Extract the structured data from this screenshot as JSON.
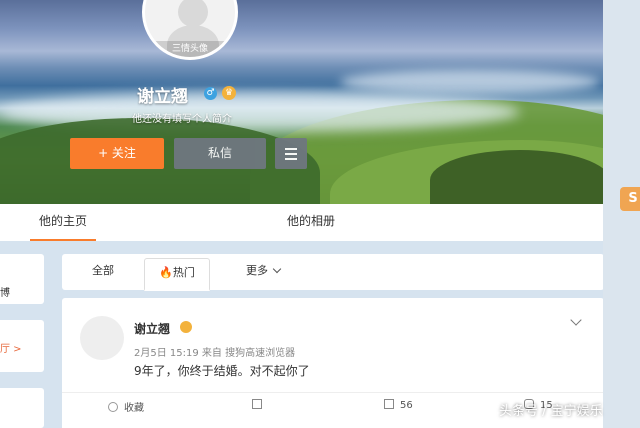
{
  "profile": {
    "avatar_caption": "三情头像",
    "username": "谢立翘",
    "gender_icon": "♂",
    "crown_icon": "♛",
    "bio": "他还没有填写个人简介",
    "follow_label": "+ 关注",
    "message_label": "私信"
  },
  "tabs": {
    "home": "他的主页",
    "album": "他的相册"
  },
  "sidebar": {
    "card1_text": "博",
    "card2_text": "厅 >"
  },
  "feed_tabs": {
    "all": "全部",
    "hot": "🔥热门",
    "more": "更多"
  },
  "post": {
    "author": "谢立翘",
    "meta": "2月5日 15:19 来自 搜狗高速浏览器",
    "text": "9年了，你终于结婚。对不起你了",
    "favorite": "收藏",
    "forward": "",
    "comments": "56",
    "likes": "15"
  },
  "weibo_badge": "S",
  "watermark": "头条号 / 宝宁娱乐",
  "colors": {
    "accent": "#f97c2c",
    "button_gray": "#6f7780"
  }
}
